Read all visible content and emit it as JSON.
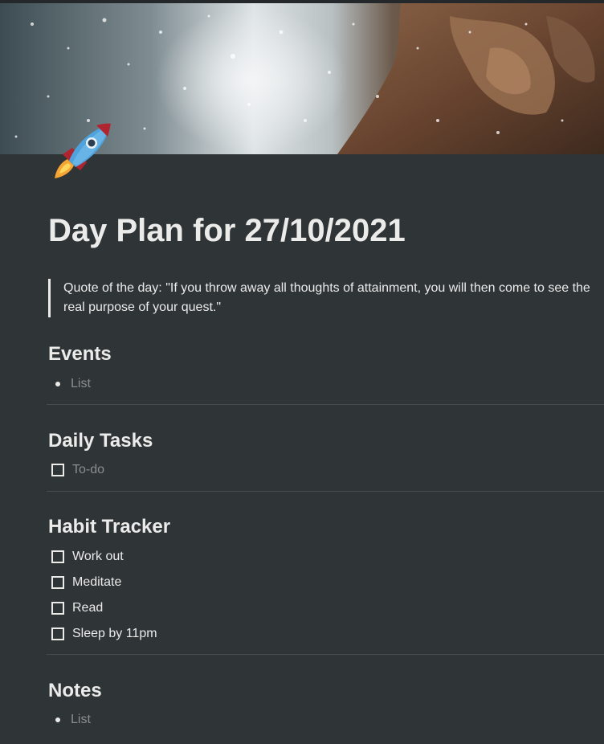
{
  "cover": {
    "icon": "rocket-icon"
  },
  "page": {
    "title": "Day Plan for 27/10/2021",
    "quote": "Quote of the day: \"If you throw away all thoughts of attainment, you will then come to see the real purpose of your quest.\""
  },
  "sections": {
    "events": {
      "heading": "Events",
      "items": [
        {
          "placeholder": "List"
        }
      ]
    },
    "daily_tasks": {
      "heading": "Daily Tasks",
      "items": [
        {
          "placeholder": "To-do",
          "checked": false
        }
      ]
    },
    "habit_tracker": {
      "heading": "Habit Tracker",
      "items": [
        {
          "label": "Work out",
          "checked": false
        },
        {
          "label": "Meditate",
          "checked": false
        },
        {
          "label": "Read",
          "checked": false
        },
        {
          "label": "Sleep by 11pm",
          "checked": false
        }
      ]
    },
    "notes": {
      "heading": "Notes",
      "items": [
        {
          "placeholder": "List"
        }
      ]
    }
  },
  "colors": {
    "background": "#2f3437",
    "text": "#ebebea",
    "placeholder": "#8b8d8f",
    "divider": "#474c50"
  }
}
